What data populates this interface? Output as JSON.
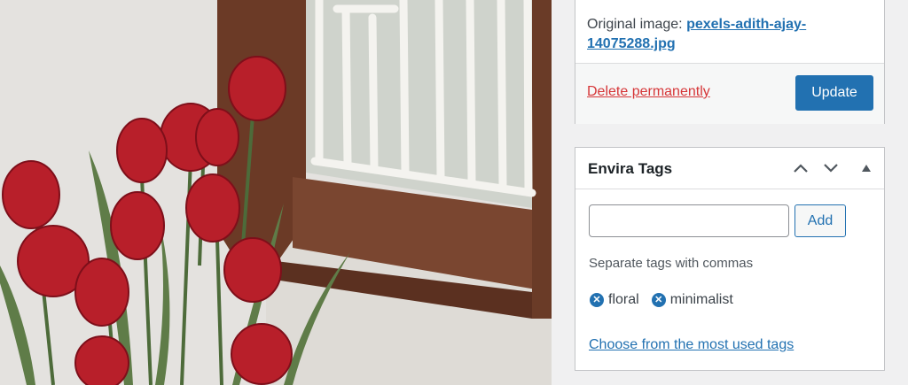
{
  "publish": {
    "original_label": "Original image:",
    "original_filename": "pexels-adith-ajay-14075288.jpg",
    "delete_label": "Delete permanently",
    "update_label": "Update"
  },
  "tags_box": {
    "title": "Envira Tags",
    "input_value": "",
    "add_label": "Add",
    "hint": "Separate tags with commas",
    "tags": [
      "floral",
      "minimalist"
    ],
    "remove_glyph": "✕",
    "most_used_label": "Choose from the most used tags"
  },
  "icons": [
    "chevron-up-icon",
    "chevron-down-icon",
    "triangle-up-icon",
    "remove-tag-icon"
  ],
  "colors": {
    "accent": "#2271b1",
    "danger": "#d63638",
    "background": "#f0f0f1",
    "panel": "#ffffff"
  }
}
